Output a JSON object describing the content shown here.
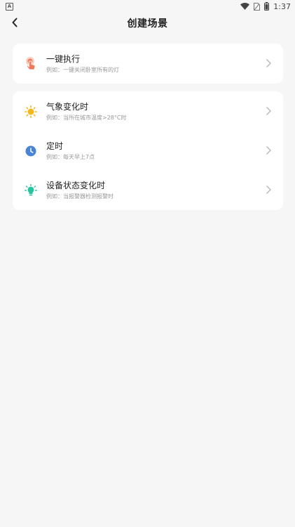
{
  "status_bar": {
    "app_icon_letter": "A",
    "time": "1:37"
  },
  "header": {
    "title": "创建场景"
  },
  "sections": {
    "manual": {
      "items": [
        {
          "title": "一键执行",
          "subtitle": "例如：一键关闭卧室所有的灯",
          "icon": "tap-hand-icon",
          "color": "#ef7a5a"
        }
      ]
    },
    "auto": {
      "items": [
        {
          "title": "气象变化时",
          "subtitle": "例如：当所在城市温度>28°C时",
          "icon": "sun-icon",
          "color": "#f5b71b"
        },
        {
          "title": "定时",
          "subtitle": "例如：每天早上7点",
          "icon": "clock-icon",
          "color": "#4a84d6"
        },
        {
          "title": "设备状态变化时",
          "subtitle": "例如：当报警器检测报警时",
          "icon": "bulb-icon",
          "color": "#26c4a0"
        }
      ]
    }
  }
}
